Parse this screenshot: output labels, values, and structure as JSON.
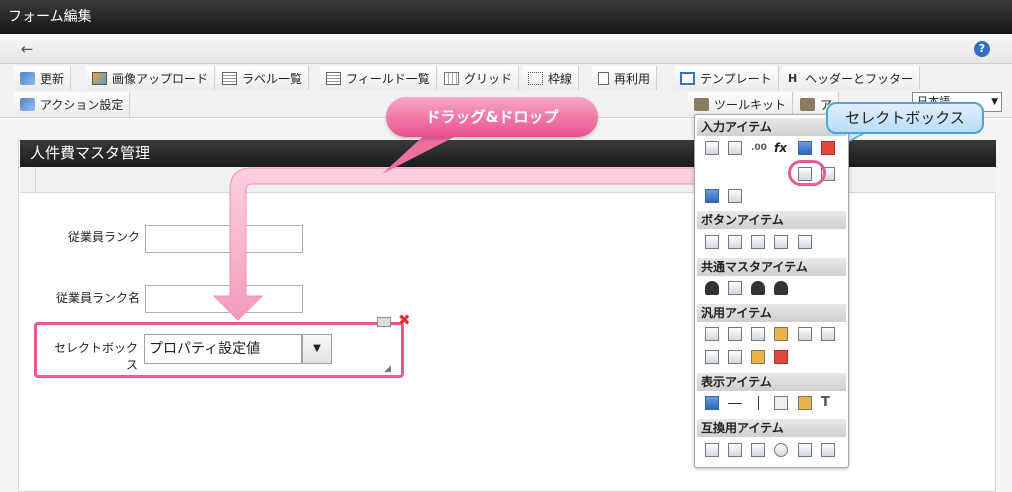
{
  "window": {
    "title": "フォーム編集"
  },
  "nav": {
    "back_icon": "arrow-left-icon",
    "help_icon": "question-icon",
    "help_glyph": "?"
  },
  "toolbar": {
    "buttons": [
      {
        "label": "更新",
        "icon": "refresh-icon"
      },
      {
        "label": "画像アップロード",
        "icon": "image-upload-icon"
      },
      {
        "label": "ラベル一覧",
        "icon": "list-icon"
      },
      {
        "label": "フィールド一覧",
        "icon": "list-icon"
      },
      {
        "label": "グリッド",
        "icon": "grid-icon"
      },
      {
        "label": "枠線",
        "icon": "frame-icon"
      },
      {
        "label": "再利用",
        "icon": "document-icon"
      },
      {
        "label": "テンプレート",
        "icon": "template-icon"
      },
      {
        "label": "ヘッダーとフッター",
        "icon": "header-icon"
      },
      {
        "label": "アクション設定",
        "icon": "action-icon"
      },
      {
        "label": "ツールキット",
        "icon": "toolbox-icon"
      },
      {
        "label": "ア",
        "icon": "toolbox-icon"
      }
    ],
    "header_icon_glyph": "H",
    "language_select": "日本語"
  },
  "form": {
    "title": "人件費マスタ管理",
    "fields": [
      {
        "label": "従業員ランク",
        "value": ""
      },
      {
        "label": "従業員ランク名",
        "value": ""
      }
    ],
    "select_field": {
      "label": "セレクトボックス",
      "value": "プロパティ設定値"
    }
  },
  "toolkit": {
    "groups": [
      {
        "title": "入力アイテム"
      },
      {
        "title": "ボタンアイテム"
      },
      {
        "title": "共通マスタアイテム"
      },
      {
        "title": "汎用アイテム"
      },
      {
        "title": "表示アイテム"
      },
      {
        "title": "互換用アイテム"
      }
    ],
    "fx_glyph": "fx",
    "decimal_glyph": ".00",
    "text_glyph": "T"
  },
  "annotations": {
    "drag_label": "ドラッグ&ドロップ",
    "tooltip": "セレクトボックス",
    "highlight_color": "#e55a92",
    "tooltip_border_color": "#4ea3dc"
  }
}
